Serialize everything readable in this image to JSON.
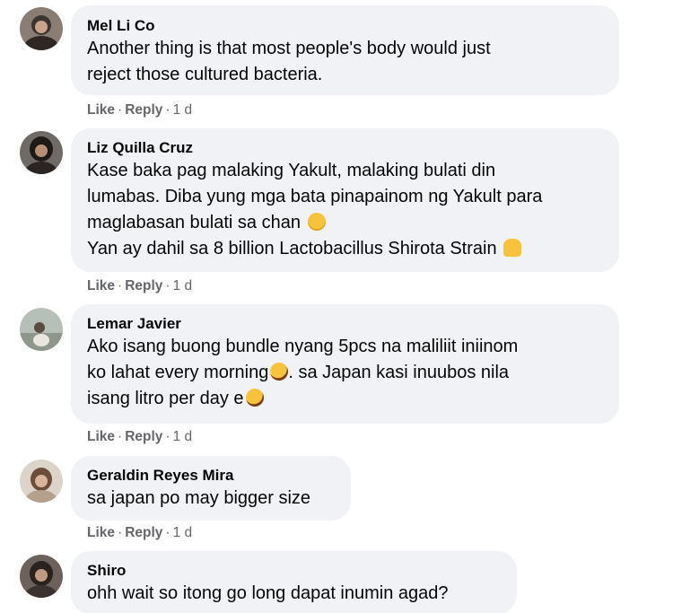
{
  "comments": [
    {
      "author": "Mel Li Co",
      "lines": [
        "Another thing is that most people's body would just",
        "reject those cultured bacteria."
      ],
      "actions": {
        "like": "Like",
        "reply": "Reply",
        "time": "1 d"
      },
      "avatar_color": "#5a4f49"
    },
    {
      "author": "Liz Quilla Cruz",
      "lines": [
        "Kase baka pag malaking Yakult, malaking bulati din",
        "lumabas. Diba yung mga bata pinapainom ng Yakult para",
        "maglabasan bulati sa chan",
        "Yan ay dahil sa 8 billion Lactobacillus Shirota Strain"
      ],
      "emojis": [
        "grinning-face",
        "raising-hands"
      ],
      "actions": {
        "like": "Like",
        "reply": "Reply",
        "time": "1 d"
      },
      "avatar_color": "#3a3230"
    },
    {
      "author": "Lemar Javier",
      "lines": [
        "Ako isang buong bundle nyang 5pcs na maliliit iniinom",
        "ko lahat every morning",
        ". sa Japan kasi inuubos nila",
        "isang litro per day e"
      ],
      "emojis": [
        "rofl-face",
        "rofl-face"
      ],
      "actions": {
        "like": "Like",
        "reply": "Reply",
        "time": "1 d"
      },
      "avatar_color": "#9aa39a"
    },
    {
      "author": "Geraldin Reyes Mira",
      "lines": [
        "sa japan po may bigger size"
      ],
      "actions": {
        "like": "Like",
        "reply": "Reply",
        "time": "1 d"
      },
      "avatar_color": "#c8b8a8"
    },
    {
      "author": "Shiro",
      "lines": [
        "ohh wait so itong go long dapat inumin agad?"
      ],
      "avatar_color": "#6b5f58"
    }
  ],
  "colors": {
    "bubble": "#f0f2f5",
    "text": "#050505",
    "meta": "#65676b"
  }
}
